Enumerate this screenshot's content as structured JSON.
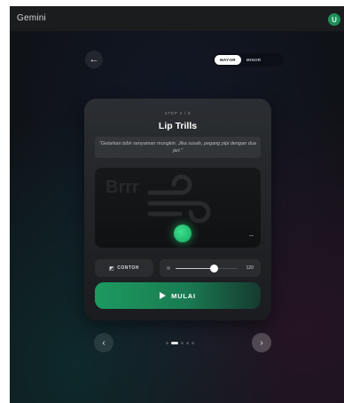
{
  "app": {
    "title": "Gemini",
    "avatar_initial": "U"
  },
  "header": {
    "back_icon": "arrow-left-icon",
    "modes": [
      {
        "label": "MAYOR",
        "active": true
      },
      {
        "label": "MINOR",
        "active": false
      }
    ]
  },
  "card": {
    "step_label": "STEP 2 / 5",
    "title": "Lip Trills",
    "instruction": "\"Getarkan bibir senyaman mungkin. Jika susah, pegang pipi dengan dua jari.\"",
    "visual": {
      "caption": "Brrr",
      "icon": "wind-icon"
    },
    "example_button": {
      "icon": "headphones-icon",
      "label": "CONTOH"
    },
    "tempo": {
      "value_label": "120",
      "level": 0.62
    },
    "start_button": {
      "icon": "play-icon",
      "label": "MULAI"
    }
  },
  "pagination": {
    "prev_icon": "chevron-left-icon",
    "next_icon": "chevron-right-icon",
    "total": 5,
    "current": 2
  },
  "colors": {
    "accent_green": "#1d9a60",
    "glow_green": "#3fe08f",
    "card_bg": "#2b2e32",
    "page_bg": "#0f1217"
  }
}
